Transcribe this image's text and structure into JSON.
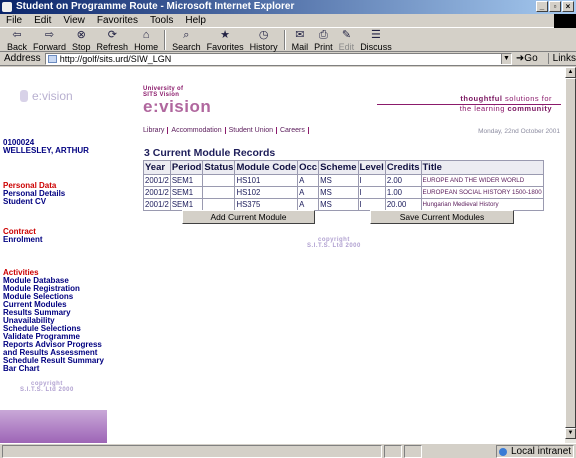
{
  "window": {
    "title": "Student on Programme Route - Microsoft Internet Explorer",
    "controls": [
      "_",
      "▫",
      "×"
    ]
  },
  "menu": [
    "File",
    "Edit",
    "View",
    "Favorites",
    "Tools",
    "Help"
  ],
  "toolbar": {
    "back": "Back",
    "forward": "Forward",
    "stop": "Stop",
    "refresh": "Refresh",
    "home": "Home",
    "search": "Search",
    "favorites": "Favorites",
    "history": "History",
    "mail": "Mail",
    "print": "Print",
    "edit": "Edit",
    "discuss": "Discuss"
  },
  "address": {
    "label": "Address",
    "url": "http://golf/sits.urd/SIW_LGN",
    "go": "Go",
    "links": "Links"
  },
  "sidebar": {
    "logo": "e:vision",
    "student_id": "0100024",
    "student_name": "WELLESLEY, ARTHUR",
    "personal_head": "Personal Data",
    "personal_items": [
      "Personal Details",
      "Student CV"
    ],
    "contract_head": "Contract",
    "contract_items": [
      "Enrolment"
    ],
    "activities_head": "Activities",
    "activities_items": [
      "Module Database",
      "Module Registration",
      "Module Selections",
      "Current Modules",
      "Results Summary",
      "Unavailability",
      "Schedule Selections",
      "Validate Programme",
      "Reports Advisor Progress",
      "and Results Assessment",
      "Schedule Result Summary",
      "Bar Chart"
    ],
    "copyright_1": "copyright",
    "copyright_2": "S.I.T.S. Ltd 2000"
  },
  "brand": {
    "line1": "University of",
    "line2": "SITS Vision",
    "logo": "e:vision"
  },
  "tagline": {
    "line1_pre": "thoughtful",
    "line1_post": " solutions for",
    "line2_pre": "the learning ",
    "line2_bold": "community"
  },
  "topnav": [
    "Library",
    "Accommodation",
    "Student Union",
    "Careers"
  ],
  "date": "Monday, 22nd October 2001",
  "heading": "3 Current Module Records",
  "table": {
    "columns": [
      "Year",
      "Period",
      "Status",
      "Module Code",
      "Occ",
      "Scheme",
      "Level",
      "Credits",
      "Title"
    ],
    "rows": [
      [
        "2001/2",
        "SEM1",
        "",
        "HS101",
        "A",
        "MS",
        "I",
        "2.00",
        "EUROPE AND THE WIDER WORLD"
      ],
      [
        "2001/2",
        "SEM1",
        "",
        "HS102",
        "A",
        "MS",
        "I",
        "1.00",
        "EUROPEAN SOCIAL HISTORY 1500-1800"
      ],
      [
        "2001/2",
        "SEM1",
        "",
        "HS375",
        "A",
        "MS",
        "I",
        "20.00",
        "Hungarian Medieval History"
      ]
    ]
  },
  "buttons": {
    "add": "Add Current Module",
    "save": "Save Current Modules"
  },
  "main_copyright_1": "copyright",
  "main_copyright_2": "S.I.T.S. Ltd 2000",
  "status": {
    "zone": "Local intranet"
  }
}
